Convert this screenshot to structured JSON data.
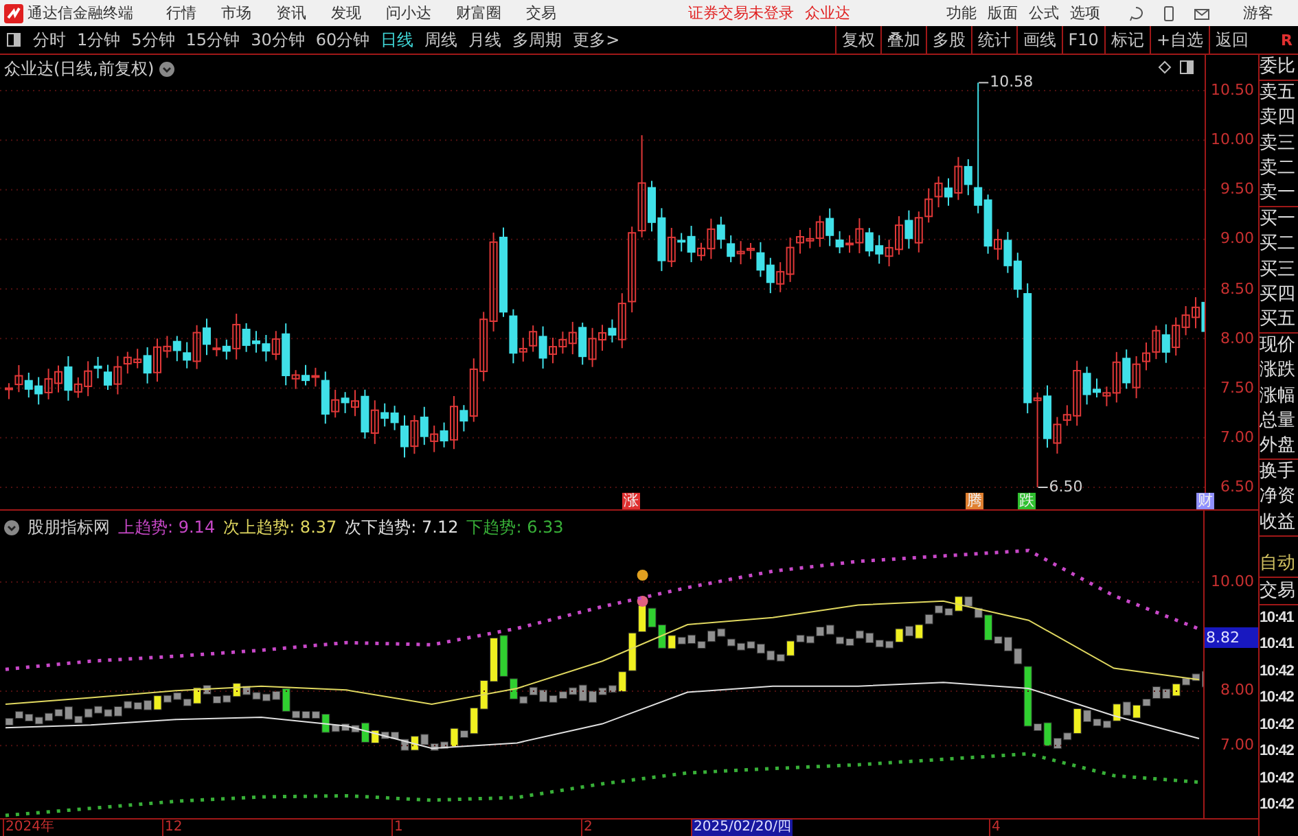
{
  "menu_bar": {
    "app_title": "通达信金融终端",
    "menus": [
      "行情",
      "市场",
      "资讯",
      "发现",
      "问小达",
      "财富圈",
      "交易"
    ],
    "notice": "证券交易未登录",
    "stock_name": "众业达",
    "options": [
      "功能",
      "版面",
      "公式",
      "选项"
    ],
    "user": "游客"
  },
  "toolbar": {
    "periods": [
      {
        "label": "分时",
        "selected": false
      },
      {
        "label": "1分钟",
        "selected": false
      },
      {
        "label": "5分钟",
        "selected": false
      },
      {
        "label": "15分钟",
        "selected": false
      },
      {
        "label": "30分钟",
        "selected": false
      },
      {
        "label": "60分钟",
        "selected": false
      },
      {
        "label": "日线",
        "selected": true
      },
      {
        "label": "周线",
        "selected": false
      },
      {
        "label": "月线",
        "selected": false
      },
      {
        "label": "多周期",
        "selected": false
      },
      {
        "label": "更多>",
        "selected": false
      }
    ],
    "tools": [
      "复权",
      "叠加",
      "多股",
      "统计",
      "画线",
      "F10",
      "标记",
      "+自选",
      "返回"
    ],
    "corner": "R"
  },
  "price_chart": {
    "title": "众业达(日线,前复权)",
    "axis_labels": [
      "10.50",
      "10.00",
      "9.50",
      "9.00",
      "8.50",
      "8.00",
      "7.50",
      "7.00",
      "6.50"
    ],
    "high_label": "10.58",
    "low_label": "6.50",
    "markers": [
      {
        "text": "涨",
        "color": "#e03030"
      },
      {
        "text": "腾",
        "color": "#e08030"
      },
      {
        "text": "跌",
        "color": "#30c030"
      },
      {
        "text": "财",
        "color": "#9090ff"
      }
    ]
  },
  "quote_panel": {
    "groups": [
      [
        "委比"
      ],
      [
        "卖五",
        "卖四",
        "卖三",
        "卖二",
        "卖一"
      ],
      [
        "买一",
        "买二",
        "买三",
        "买四",
        "买五"
      ],
      [
        "现价",
        "涨跌",
        "涨幅",
        "总量",
        "外盘"
      ],
      [
        "换手",
        "净资",
        "收益"
      ]
    ]
  },
  "indicator": {
    "name": "股朋指标网",
    "legend": [
      {
        "value": ": 9.14"
      },
      {
        "value": ": 8.37"
      },
      {
        "value": ": 7.12"
      },
      {
        "value": ": 6.33"
      }
    ],
    "cursor_value": "8.82",
    "chart_data": {
      "type": "line",
      "grid": true,
      "ylim": [
        5.67,
        11.31
      ],
      "yticks": [
        {
          "value": 10,
          "label": "10.00"
        },
        {
          "value": 8,
          "label": "8.00"
        },
        {
          "value": 7,
          "label": "7.00"
        }
      ],
      "series": [
        {
          "name": "上趋势",
          "color": "#c848c8",
          "line_style": "dotted",
          "values": [
            8.4,
            8.55,
            8.64,
            8.75,
            8.89,
            8.85,
            9.15,
            9.55,
            9.9,
            10.2,
            10.38,
            10.48,
            10.58,
            9.75,
            9.14
          ]
        },
        {
          "name": "次上趋势",
          "color": "#e0d860",
          "line_style": "solid",
          "values": [
            7.76,
            7.88,
            8.01,
            8.09,
            8.02,
            7.76,
            8.05,
            8.55,
            9.22,
            9.35,
            9.58,
            9.65,
            9.3,
            8.42,
            8.21
          ]
        },
        {
          "name": "次下趋势",
          "color": "#e0e0e0",
          "line_style": "solid",
          "values": [
            7.33,
            7.38,
            7.48,
            7.52,
            7.36,
            6.95,
            7.05,
            7.4,
            7.98,
            8.09,
            8.09,
            8.16,
            8.05,
            7.55,
            7.13
          ]
        },
        {
          "name": "下趋势",
          "color": "#38b038",
          "line_style": "dotted",
          "values": [
            5.72,
            5.85,
            5.98,
            6.06,
            6.08,
            6.0,
            6.05,
            6.3,
            6.5,
            6.58,
            6.65,
            6.75,
            6.85,
            6.45,
            6.33
          ]
        }
      ]
    }
  },
  "trade_panel": {
    "mode": "自动",
    "title": "交易",
    "times": [
      "10:41",
      "10:41",
      "10:42",
      "10:42",
      "10:42",
      "10:42",
      "10:42",
      "10:42"
    ]
  },
  "date_axis": [
    {
      "label": "2024年",
      "highlighted": false
    },
    {
      "label": "12",
      "highlighted": false
    },
    {
      "label": "1",
      "highlighted": false
    },
    {
      "label": "2",
      "highlighted": false
    },
    {
      "label": "2025/02/20/四",
      "highlighted": true
    },
    {
      "label": "4",
      "highlighted": false
    }
  ]
}
